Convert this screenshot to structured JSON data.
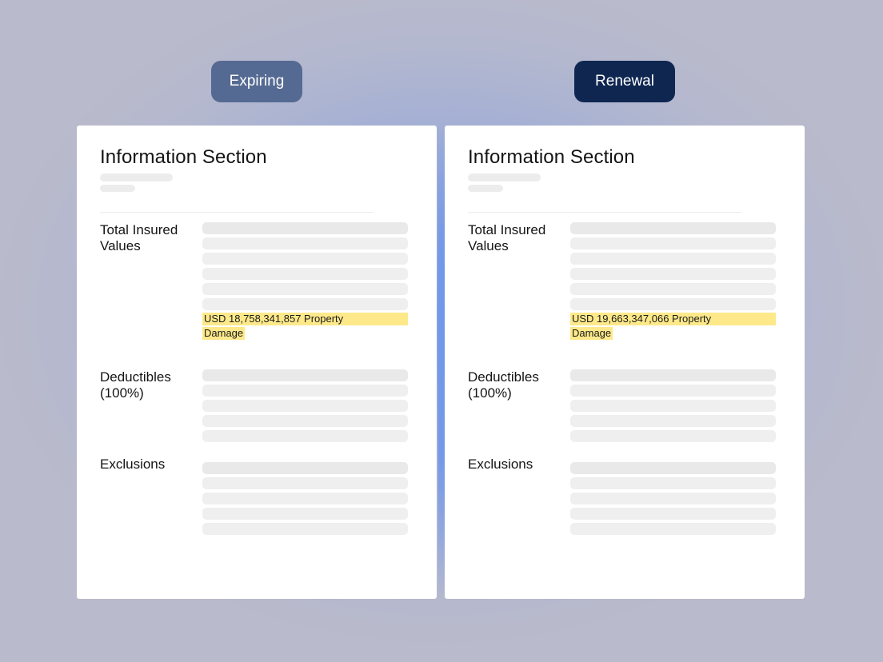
{
  "columns": [
    {
      "id": "expiring",
      "tag_label": "Expiring",
      "tag_color": "#556a92",
      "title": "Information Section",
      "sections": {
        "tiv_label": "Total Insured Values",
        "tiv_value_line1": "USD 18,758,341,857 Property",
        "tiv_value_line2": "Damage",
        "deductibles_label": "Deductibles (100%)",
        "exclusions_label": "Exclusions"
      }
    },
    {
      "id": "renewal",
      "tag_label": "Renewal",
      "tag_color": "#0f2651",
      "title": "Information Section",
      "sections": {
        "tiv_label": "Total Insured Values",
        "tiv_value_line1": "USD 19,663,347,066 Property",
        "tiv_value_line2": "Damage",
        "deductibles_label": "Deductibles (100%)",
        "exclusions_label": "Exclusions"
      }
    }
  ],
  "colors": {
    "highlight": "#fde98a",
    "placeholder": "#efefef",
    "card": "#ffffff"
  }
}
